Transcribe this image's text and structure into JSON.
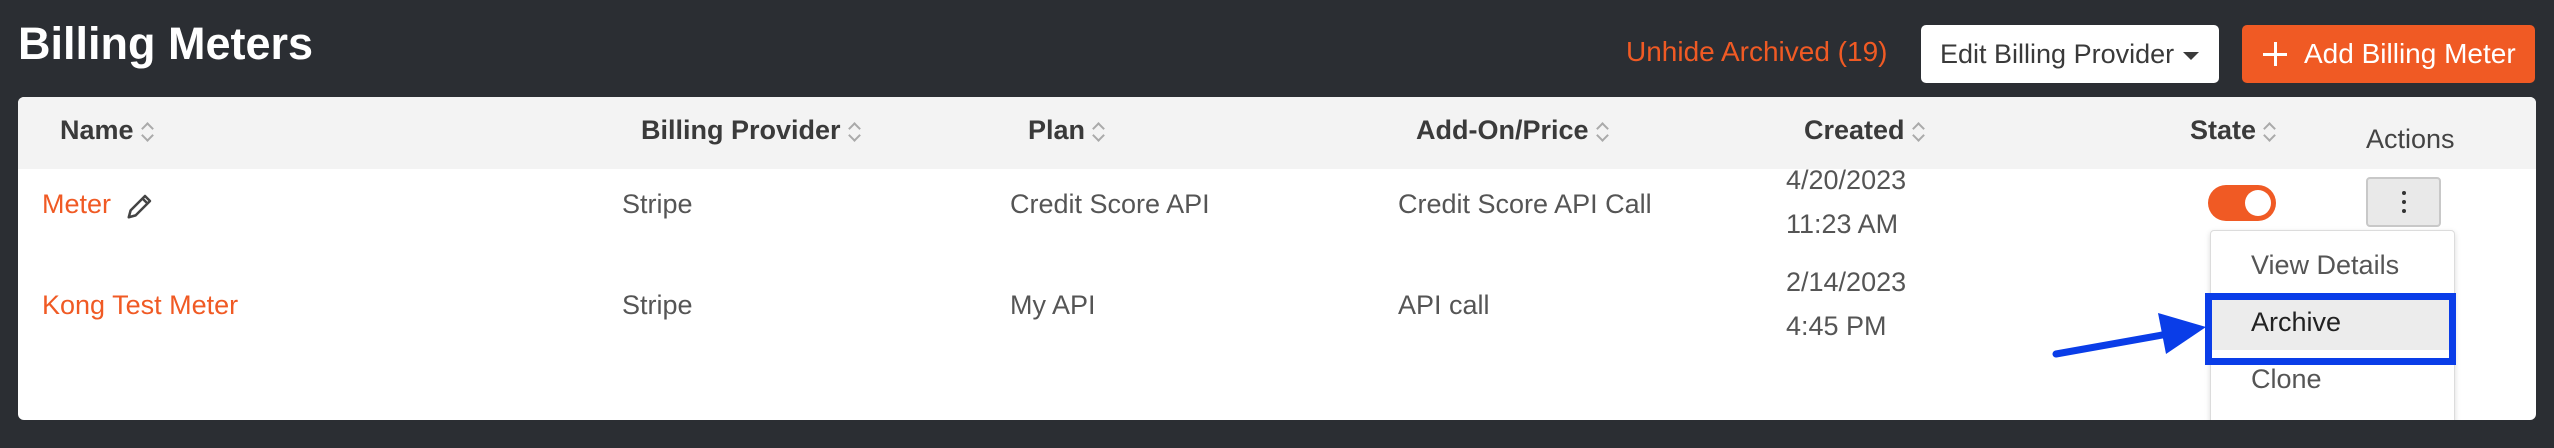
{
  "header": {
    "title": "Billing Meters",
    "unhide_label": "Unhide Archived (19)",
    "edit_provider_label": "Edit Billing Provider",
    "add_meter_label": "Add Billing Meter"
  },
  "table": {
    "columns": {
      "name": "Name",
      "provider": "Billing Provider",
      "plan": "Plan",
      "addon": "Add-On/Price",
      "created": "Created",
      "state": "State",
      "actions": "Actions"
    },
    "rows": [
      {
        "name": "Meter",
        "provider": "Stripe",
        "plan": "Credit Score API",
        "addon": "Credit Score API Call",
        "created_date": "4/20/2023",
        "created_time": "11:23 AM",
        "state_on": true
      },
      {
        "name": "Kong Test Meter",
        "provider": "Stripe",
        "plan": "My API",
        "addon": "API call",
        "created_date": "2/14/2023",
        "created_time": "4:45 PM"
      }
    ]
  },
  "actions_menu": {
    "items": [
      "View Details",
      "Archive",
      "Clone"
    ],
    "highlighted": "Archive"
  },
  "colors": {
    "accent": "#f05a24",
    "background": "#2b2e33",
    "highlight": "#0a3de8"
  }
}
